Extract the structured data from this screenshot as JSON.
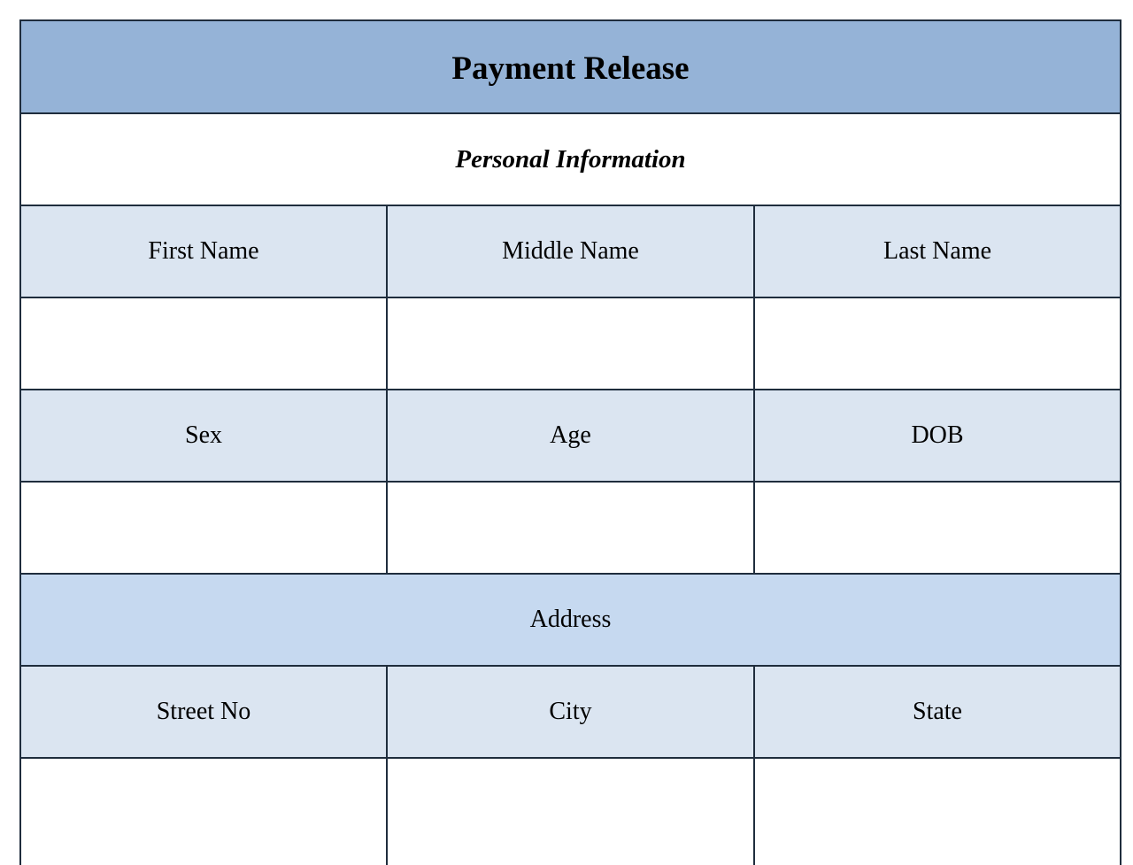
{
  "form": {
    "title": "Payment Release",
    "colors": {
      "title_bg": "#95b3d7",
      "header_bg": "#dbe5f1",
      "address_bg": "#c6d9f0",
      "border": "#1f2d3d"
    },
    "personal_information": {
      "heading": "Personal Information",
      "rows": [
        {
          "labels": [
            "First Name",
            "Middle Name",
            "Last Name"
          ],
          "values": [
            "",
            "",
            ""
          ]
        },
        {
          "labels": [
            "Sex",
            "Age",
            "DOB"
          ],
          "values": [
            "",
            "",
            ""
          ]
        }
      ]
    },
    "address": {
      "heading": "Address",
      "rows": [
        {
          "labels": [
            "Street No",
            "City",
            "State"
          ],
          "values": [
            "",
            "",
            ""
          ]
        }
      ]
    }
  }
}
